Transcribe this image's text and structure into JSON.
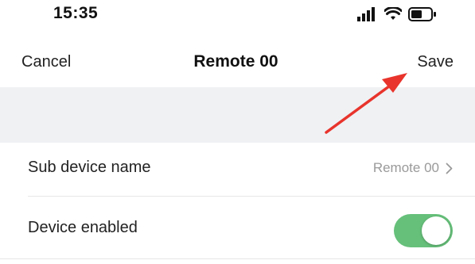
{
  "status_bar": {
    "time": "15:35",
    "icons": [
      "signal-icon",
      "wifi-icon",
      "battery-icon"
    ]
  },
  "nav": {
    "cancel_label": "Cancel",
    "title": "Remote 00",
    "save_label": "Save"
  },
  "settings": {
    "sub_device_name": {
      "label": "Sub device name",
      "value": "Remote 00"
    },
    "device_enabled": {
      "label": "Device enabled",
      "enabled": true
    }
  },
  "colors": {
    "toggle_on": "#66c07a",
    "annotation_arrow": "#e8342c",
    "section_background": "#f0f1f3"
  }
}
